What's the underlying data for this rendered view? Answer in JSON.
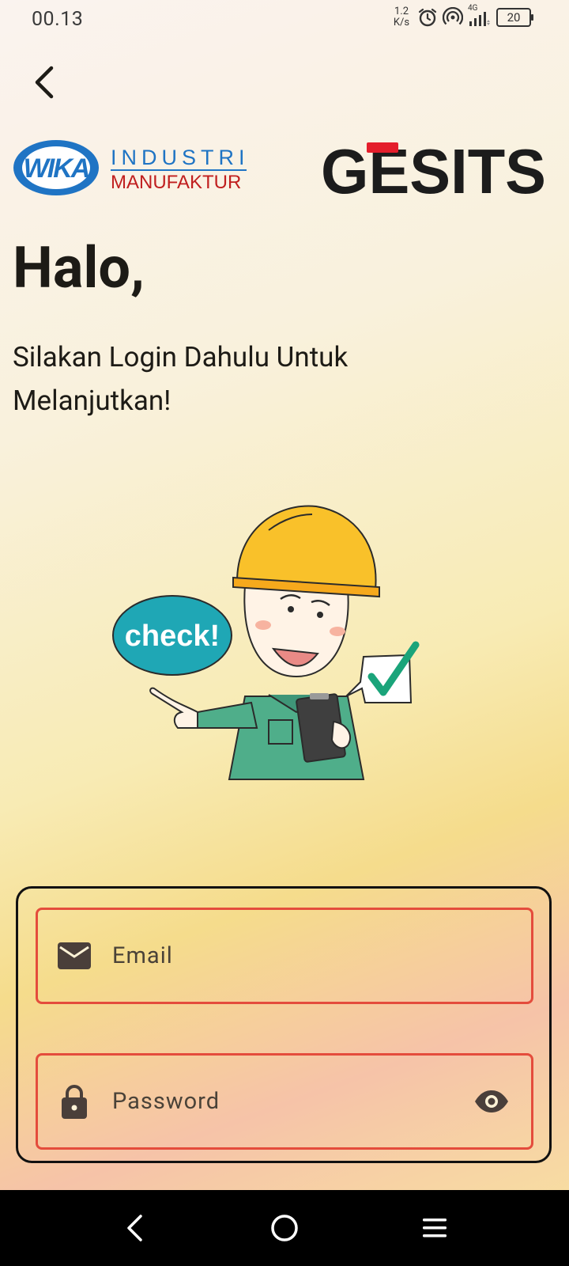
{
  "status_bar": {
    "time": "00.13",
    "net_speed_value": "1.2",
    "net_speed_unit": "K/s",
    "network_type": "4G",
    "battery_level": "20",
    "icons": [
      "alarm-icon",
      "hotspot-icon",
      "signal-icon",
      "battery-icon"
    ]
  },
  "header": {
    "back_icon": "chevron-left-icon"
  },
  "logos": {
    "wika_mark": "WIKA",
    "wika_line1": "INDUSTRI",
    "wika_line2": "MANUFAKTUR",
    "gesits": "GESITS"
  },
  "greeting": "Halo,",
  "subtitle": "Silakan Login Dahulu Untuk Melanjutkan!",
  "illustration": {
    "speech_bubble": "check!"
  },
  "form": {
    "email": {
      "placeholder": "Email",
      "value": "",
      "icon": "mail-icon"
    },
    "password": {
      "placeholder": "Password",
      "value": "",
      "icon": "lock-icon",
      "toggle_icon": "eye-icon"
    }
  },
  "nav": {
    "back": "back-nav-icon",
    "home": "home-nav-icon",
    "menu": "menu-nav-icon"
  },
  "colors": {
    "field_border": "#e44c3c",
    "card_border": "#111111",
    "wika_blue": "#1f74c4",
    "wika_red": "#c01f1f",
    "gesits_red": "#e41e2b",
    "helmet": "#f9c12a"
  }
}
